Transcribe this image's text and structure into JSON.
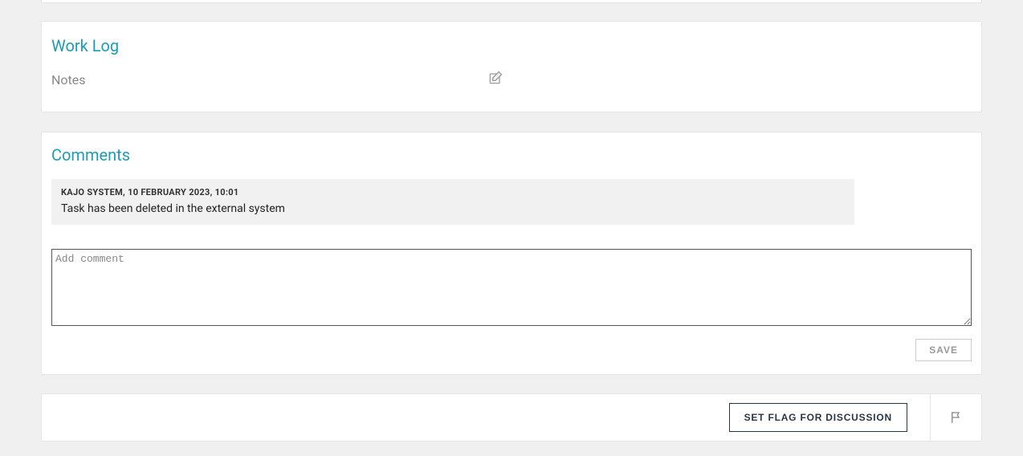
{
  "worklog": {
    "title": "Work Log",
    "notes_label": "Notes"
  },
  "comments": {
    "title": "Comments",
    "items": [
      {
        "meta": "KAJO SYSTEM, 10 FEBRUARY 2023, 10:01",
        "text": "Task has been deleted in the external system"
      }
    ],
    "textarea_placeholder": "Add comment",
    "save_label": "SAVE"
  },
  "actions": {
    "set_flag_label": "SET FLAG FOR DISCUSSION"
  }
}
